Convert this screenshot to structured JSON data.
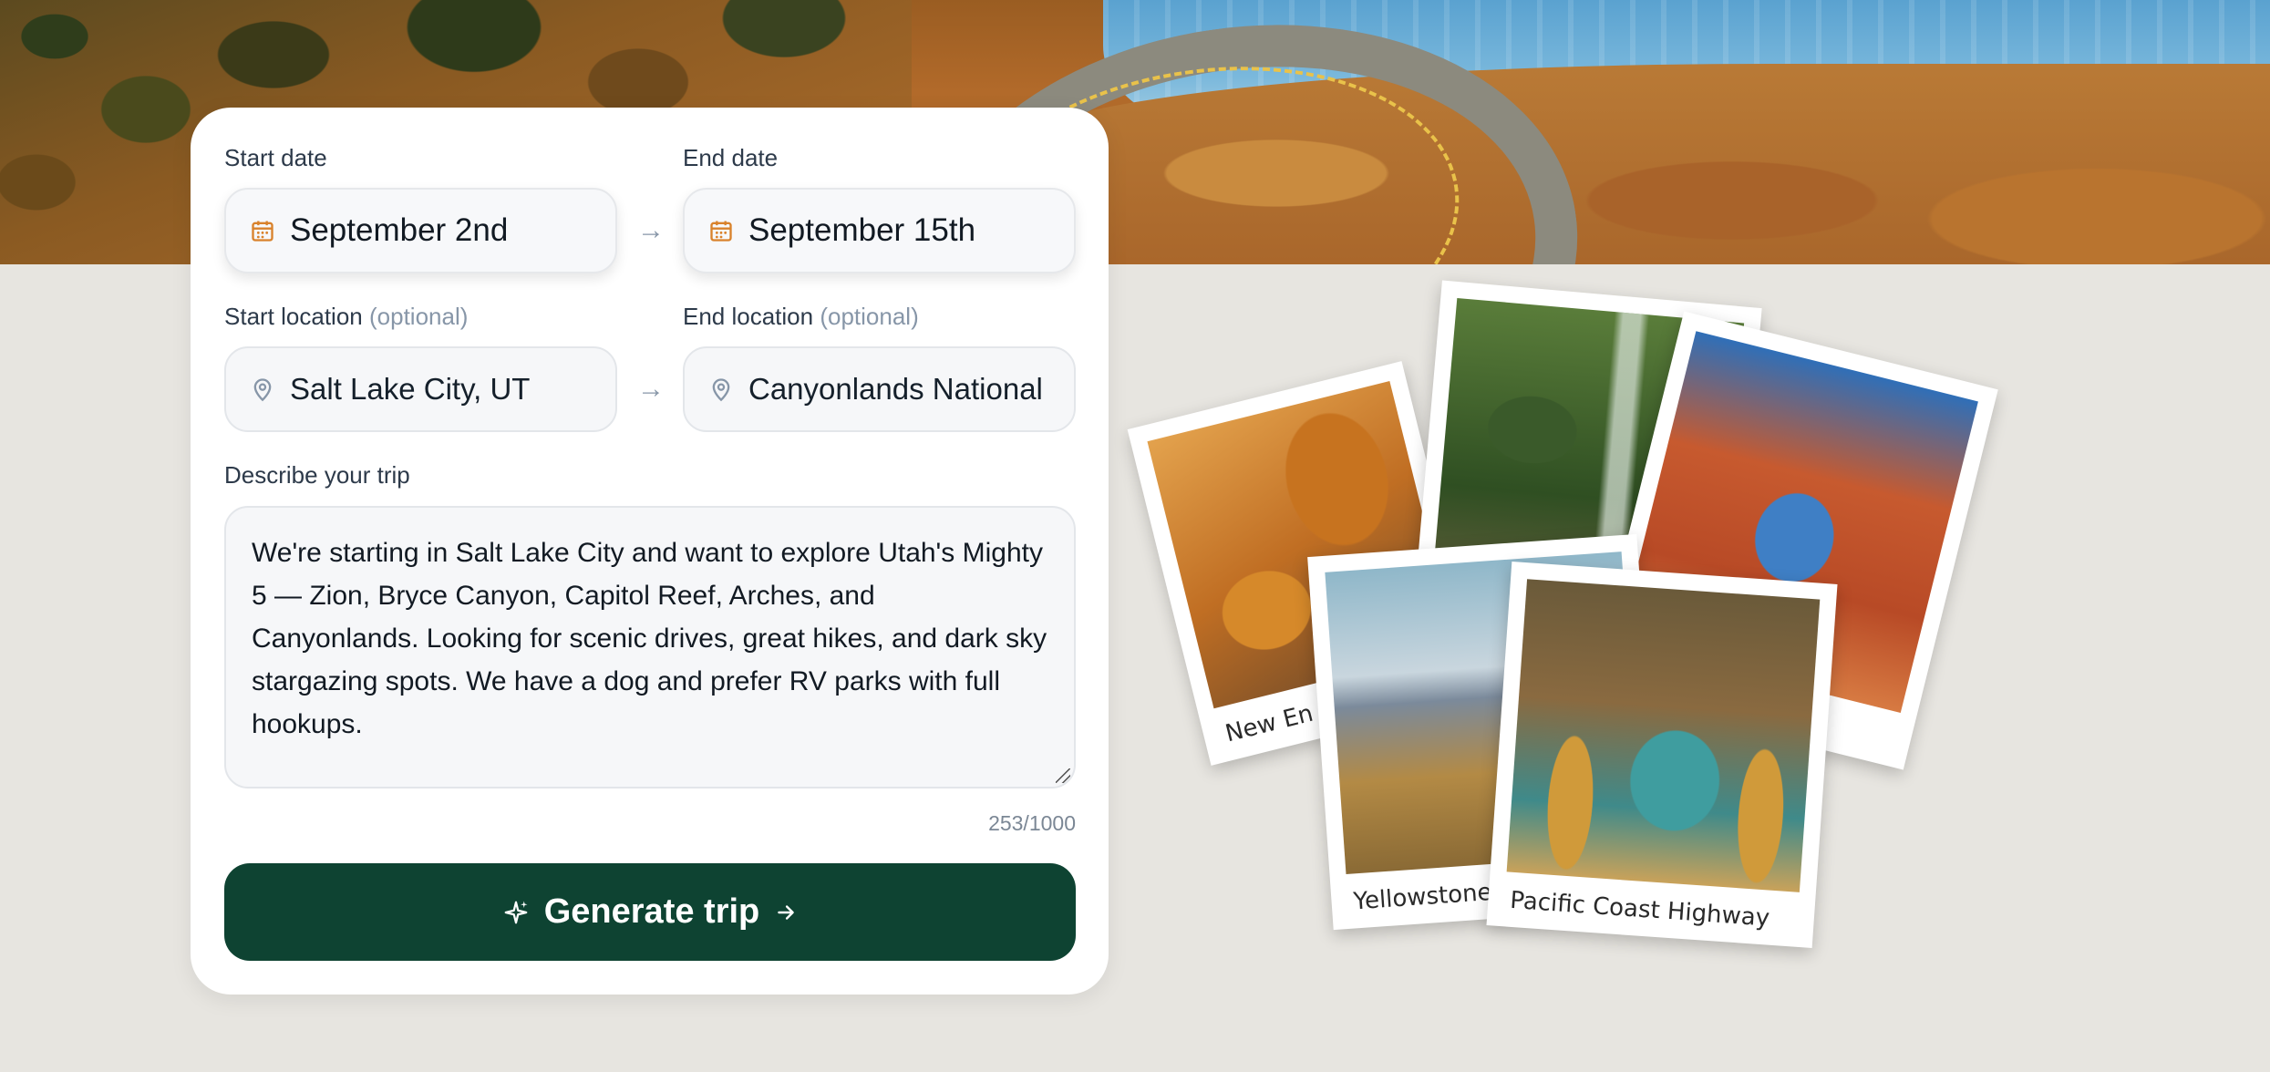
{
  "form": {
    "start_date": {
      "label": "Start date",
      "value": "September 2nd"
    },
    "end_date": {
      "label": "End date",
      "value": "September 15th"
    },
    "start_location": {
      "label": "Start location",
      "optional": "(optional)",
      "value": "Salt Lake City, UT"
    },
    "end_location": {
      "label": "End location",
      "optional": "(optional)",
      "value": "Canyonlands National Pa"
    },
    "description": {
      "label": "Describe your trip",
      "value": "We're starting in Salt Lake City and want to explore Utah's Mighty 5 — Zion, Bryce Canyon, Capitol Reef, Arches, and Canyonlands. Looking for scenic drives, great hikes, and dark sky stargazing spots. We have a dog and prefer RV parks with full hookups."
    },
    "char_count": "253/1000",
    "generate_label": "Generate trip",
    "arrow_glyph": "→"
  },
  "collage": {
    "captions": [
      "New En",
      "Yellowstone",
      "Pacific Coast Highway"
    ]
  },
  "colors": {
    "accent": "#0e4332",
    "date_icon": "#d9822b",
    "location_icon": "#8796a8",
    "background": "#e7e5e0"
  },
  "icons": {
    "date": "calendar-icon",
    "location": "map-pin-icon",
    "generate": "sparkle-icon",
    "generate_arrow": "arrow-right-icon"
  }
}
